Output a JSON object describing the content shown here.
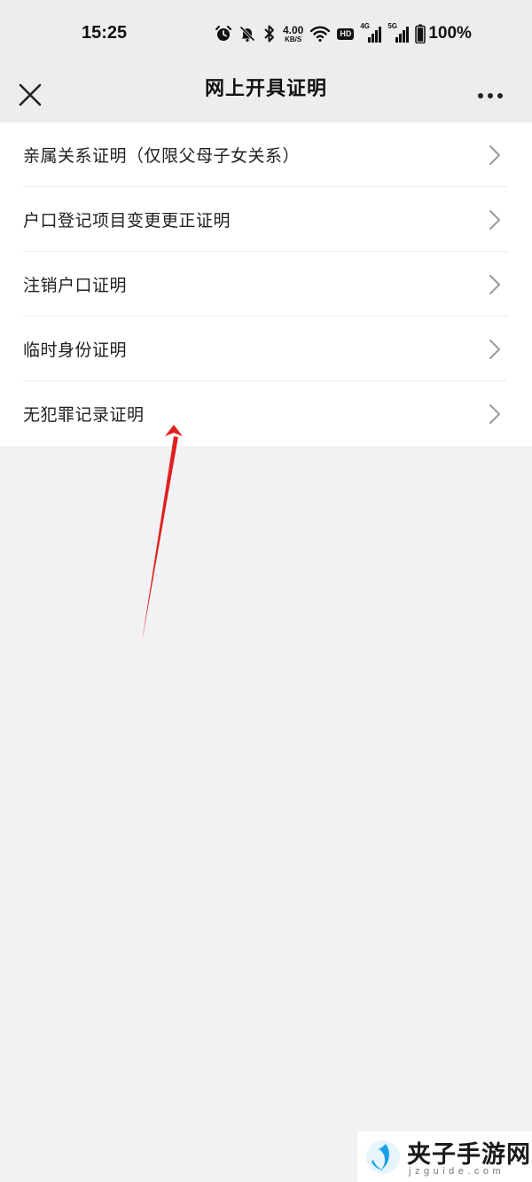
{
  "status_bar": {
    "time": "15:25",
    "net_speed_value": "4.00",
    "net_speed_unit": "KB/S",
    "hd_label": "HD",
    "signal_1_label": "4G",
    "signal_2_label": "5G",
    "battery_percent": "100%",
    "icons": [
      "alarm-icon",
      "mute-icon",
      "bluetooth-icon",
      "wifi-icon",
      "battery-icon"
    ]
  },
  "nav": {
    "title": "网上开具证明",
    "close_icon": "close-icon",
    "more_icon": "more-icon"
  },
  "menu": {
    "items": [
      {
        "label": "亲属关系证明（仅限父母子女关系）"
      },
      {
        "label": "户口登记项目变更更正证明"
      },
      {
        "label": "注销户口证明"
      },
      {
        "label": "临时身份证明"
      },
      {
        "label": "无犯罪记录证明"
      }
    ]
  },
  "annotation": {
    "arrow_color": "#e02020"
  },
  "watermark": {
    "title": "夹子手游网",
    "subtitle": "jzguide.com",
    "logo_color": "#1aa0e8"
  }
}
